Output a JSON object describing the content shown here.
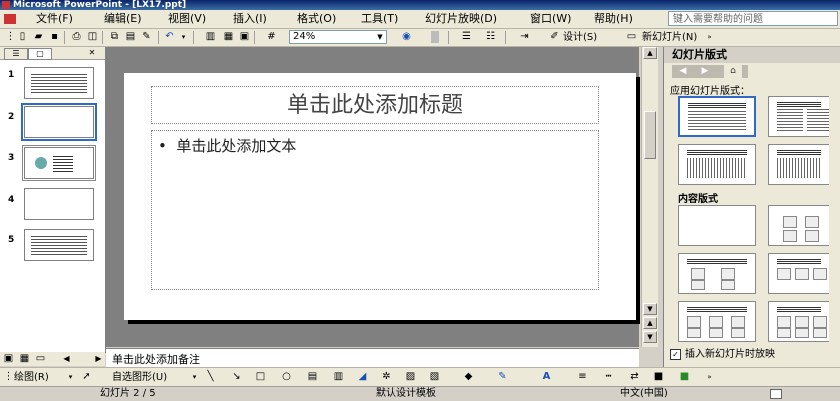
{
  "window": {
    "title": "Microsoft PowerPoint - [LX17.ppt]"
  },
  "menu": [
    {
      "label": "文件(F)"
    },
    {
      "label": "编辑(E)"
    },
    {
      "label": "视图(V)"
    },
    {
      "label": "插入(I)"
    },
    {
      "label": "格式(O)"
    },
    {
      "label": "工具(T)"
    },
    {
      "label": "幻灯片放映(D)"
    },
    {
      "label": "窗口(W)"
    },
    {
      "label": "帮助(H)"
    }
  ],
  "help_box": {
    "placeholder": "键入需要帮助的问题"
  },
  "toolbar": {
    "zoom": "24%",
    "design_label": "设计(S)",
    "new_slide_label": "新幻灯片(N)"
  },
  "slides": [
    {
      "number": "1"
    },
    {
      "number": "2"
    },
    {
      "number": "3"
    },
    {
      "number": "4"
    },
    {
      "number": "5"
    }
  ],
  "slide": {
    "title_placeholder": "单击此处添加标题",
    "body_placeholder": "单击此处添加文本",
    "bullet": "•"
  },
  "notes": {
    "placeholder": "单击此处添加备注"
  },
  "task_pane": {
    "title": "幻灯片版式",
    "apply_label": "应用幻灯片版式：",
    "content_section": "内容版式",
    "checkbox_label": "插入新幻灯片时放映",
    "checkbox_mark": "✓"
  },
  "drawing_toolbar": {
    "draw_label": "绘图(R)",
    "autoshapes_label": "自选图形(U)"
  },
  "status_bar": {
    "slide_info": "幻灯片 2 / 5",
    "template": "默认设计模板",
    "language": "中文(中国)"
  }
}
